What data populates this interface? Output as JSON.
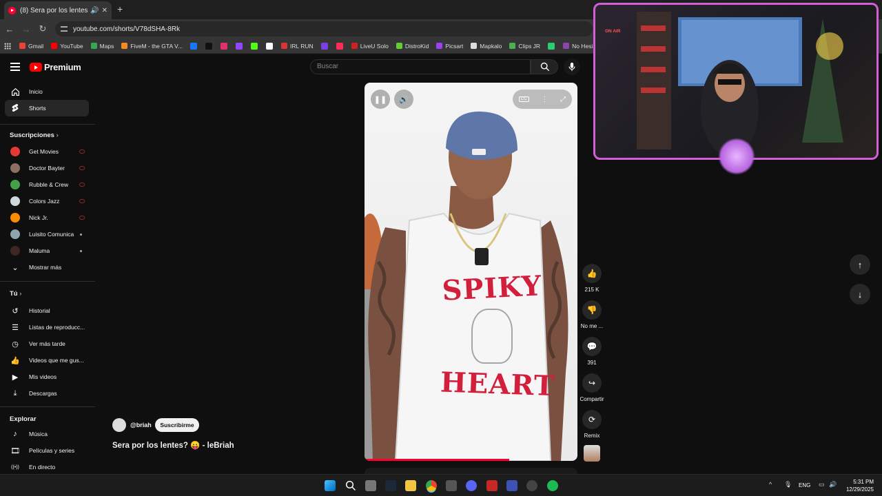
{
  "browser": {
    "tab_title": "(8) Sera por los lentes? 😛",
    "url": "youtube.com/shorts/V78dSHA-8Rk",
    "bookmarks": [
      {
        "label": "Gmail",
        "color": "#ea4335"
      },
      {
        "label": "YouTube",
        "color": "#ff0000"
      },
      {
        "label": "Maps",
        "color": "#34a853"
      },
      {
        "label": "FiveM - the GTA V...",
        "color": "#f38b23"
      },
      {
        "label": "",
        "color": "#1877f2"
      },
      {
        "label": "",
        "color": "#111111"
      },
      {
        "label": "",
        "color": "#e1306c"
      },
      {
        "label": "",
        "color": "#9146ff"
      },
      {
        "label": "",
        "color": "#53fc18"
      },
      {
        "label": "",
        "color": "#ffffff"
      },
      {
        "label": "IRL RUN",
        "color": "#d33"
      },
      {
        "label": "",
        "color": "#7b3fe4"
      },
      {
        "label": "",
        "color": "#ff2d55"
      },
      {
        "label": "LiveU Solo",
        "color": "#c22"
      },
      {
        "label": "DistroKid",
        "color": "#6c3"
      },
      {
        "label": "Picsart",
        "color": "#a13ef1"
      },
      {
        "label": "Mapkalo",
        "color": "#ddd"
      },
      {
        "label": "Clips JR",
        "color": "#4caf50"
      },
      {
        "label": "",
        "color": "#2ecc71"
      },
      {
        "label": "No Hesi",
        "color": "#8e44ad"
      }
    ]
  },
  "header": {
    "logo_text": "Premium",
    "search_placeholder": "Buscar"
  },
  "sidebar": {
    "main": [
      {
        "label": "Inicio",
        "icon": "home-icon",
        "active": false
      },
      {
        "label": "Shorts",
        "icon": "shorts-icon",
        "active": true
      }
    ],
    "subscriptions_title": "Suscripciones",
    "subscriptions": [
      {
        "label": "Get Movies",
        "color": "#e53935",
        "indicator": "live"
      },
      {
        "label": "Doctor Bayter",
        "color": "#8d6e63",
        "indicator": "live"
      },
      {
        "label": "Rubble & Crew",
        "color": "#43a047",
        "indicator": "live"
      },
      {
        "label": "Colors Jazz",
        "color": "#cfd8dc",
        "indicator": "live"
      },
      {
        "label": "Nick Jr.",
        "color": "#fb8c00",
        "indicator": "live"
      },
      {
        "label": "Luisito Comunica",
        "color": "#90a4ae",
        "indicator": "dot"
      },
      {
        "label": "Maluma",
        "color": "#3e2723",
        "indicator": "dot"
      }
    ],
    "show_more": "Mostrar más",
    "you_title": "Tú",
    "you": [
      {
        "label": "Historial",
        "icon": "history-icon"
      },
      {
        "label": "Listas de reproducc...",
        "icon": "playlists-icon"
      },
      {
        "label": "Ver más tarde",
        "icon": "watch-later-icon"
      },
      {
        "label": "Videos que me gus...",
        "icon": "like-icon"
      },
      {
        "label": "Mis videos",
        "icon": "my-videos-icon"
      },
      {
        "label": "Descargas",
        "icon": "downloads-icon"
      }
    ],
    "explore_title": "Explorar",
    "explore": [
      {
        "label": "Música",
        "icon": "music-icon"
      },
      {
        "label": "Películas y series",
        "icon": "movies-icon"
      },
      {
        "label": "En directo",
        "icon": "live-icon"
      }
    ]
  },
  "short": {
    "channel": "@briah",
    "subscribe": "Suscribirme",
    "title": "Sera por los lentes? 😛 - leBriah",
    "progress": 0.68,
    "shirt_text": [
      "SPIKY",
      "HEART"
    ]
  },
  "actions": {
    "likes": "215 K",
    "dislike": "No me ...",
    "comments": "391",
    "share": "Compartir",
    "remix": "Remix"
  },
  "overlay": {
    "on_air": "ON AIR"
  },
  "taskbar": {
    "lang": "ENG",
    "time": "5:31 PM",
    "date": "12/29/2025"
  }
}
